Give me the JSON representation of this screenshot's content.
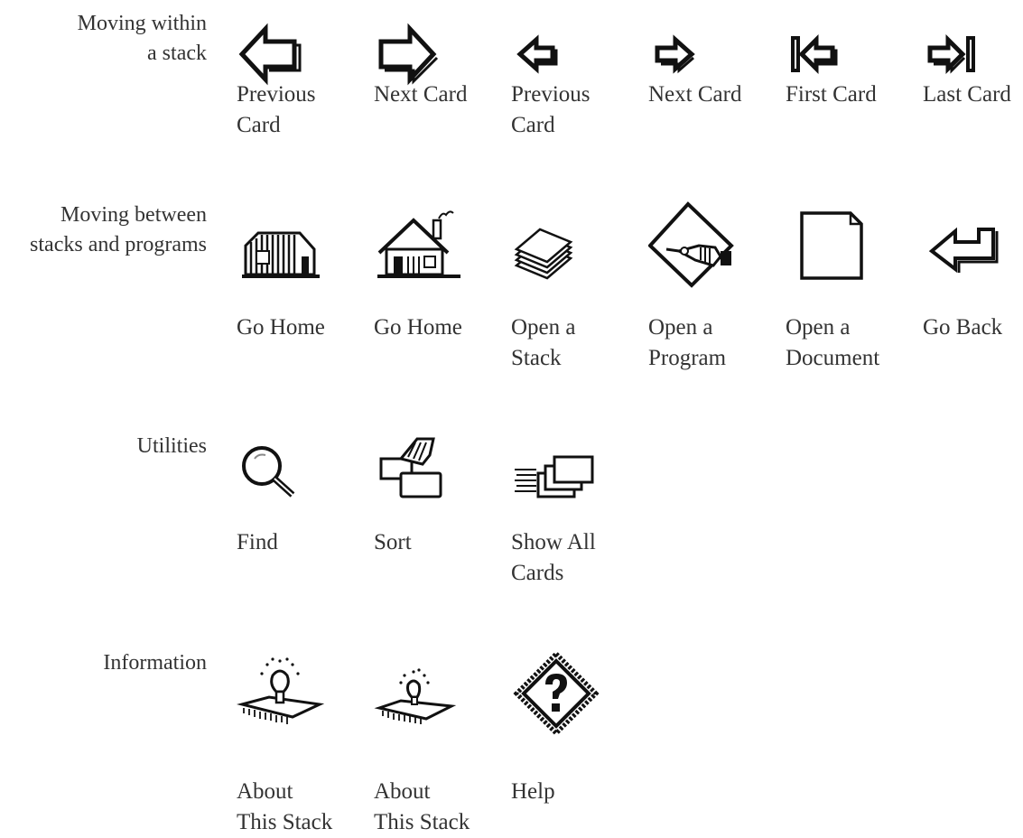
{
  "sections": [
    {
      "heading": "Moving within\na stack",
      "items": [
        {
          "icon": "previous-card-icon",
          "label": "Previous\nCard"
        },
        {
          "icon": "next-card-icon",
          "label": "Next Card"
        },
        {
          "icon": "previous-card-small-icon",
          "label": "Previous\nCard"
        },
        {
          "icon": "next-card-small-icon",
          "label": "Next Card"
        },
        {
          "icon": "first-card-icon",
          "label": "First Card"
        },
        {
          "icon": "last-card-icon",
          "label": "Last Card"
        }
      ]
    },
    {
      "heading": "Moving between\nstacks and programs",
      "items": [
        {
          "icon": "home-barn-icon",
          "label": "Go Home"
        },
        {
          "icon": "home-house-icon",
          "label": "Go Home"
        },
        {
          "icon": "stack-icon",
          "label": "Open a\nStack"
        },
        {
          "icon": "program-icon",
          "label": "Open a\nProgram"
        },
        {
          "icon": "document-icon",
          "label": "Open a\nDocument"
        },
        {
          "icon": "go-back-icon",
          "label": "Go Back"
        }
      ]
    },
    {
      "heading": "Utilities",
      "items": [
        {
          "icon": "magnifier-icon",
          "label": "Find"
        },
        {
          "icon": "sort-icon",
          "label": "Sort"
        },
        {
          "icon": "show-all-cards-icon",
          "label": "Show All\nCards"
        }
      ]
    },
    {
      "heading": "Information",
      "items": [
        {
          "icon": "about-stack-icon",
          "label": "About\nThis Stack"
        },
        {
          "icon": "about-stack-small-icon",
          "label": "About\nThis Stack"
        },
        {
          "icon": "help-icon",
          "label": "Help"
        }
      ]
    }
  ]
}
